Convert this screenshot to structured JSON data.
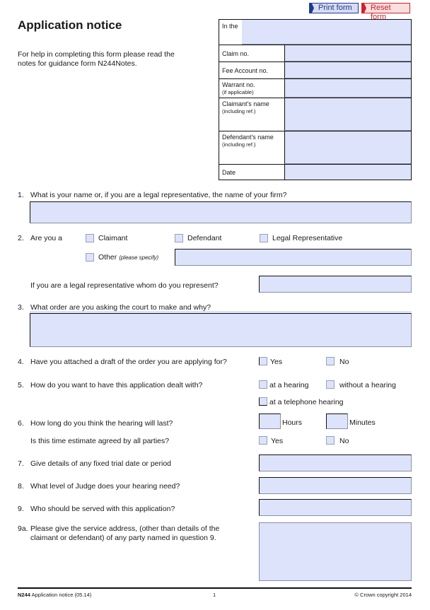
{
  "toolbar": {
    "print_label": "Print form",
    "reset_label": "Reset form",
    "print_color": "#1f3a94",
    "reset_color": "#d0202a"
  },
  "header": {
    "title": "Application notice",
    "help_line1": "For help in completing this form please read the",
    "help_line2": "notes for guidance form N244Notes."
  },
  "court_box": {
    "in_the": "In the",
    "claim_no": "Claim no.",
    "fee_account_no": "Fee Account no.",
    "warrant_no": "Warrant no.",
    "warrant_sub": "(if applicable)",
    "claimant_name": "Claimant's name",
    "claimant_sub": "(including ref.)",
    "defendant_name": "Defendant's name",
    "defendant_sub": "(including ref.)",
    "date": "Date",
    "field_color": "#dde3fb"
  },
  "questions": {
    "q1": {
      "num": "1.",
      "text": "What is your name or, if you are a legal representative, the name of your firm?"
    },
    "q2": {
      "num": "2.",
      "text": "Are you a",
      "options": [
        "Claimant",
        "Defendant",
        "Legal Representative"
      ],
      "other_label": "Other",
      "other_hint": "(please specify)",
      "rep_text": "If you are a legal representative whom do you represent?"
    },
    "q3": {
      "num": "3.",
      "text": "What order are you asking the court to make and why?"
    },
    "q4": {
      "num": "4.",
      "text": "Have you attached a draft of the order you are applying for?",
      "yes": "Yes",
      "no": "No"
    },
    "q5": {
      "num": "5.",
      "text": "How do you want to have this application dealt with?",
      "options": [
        "at a hearing",
        "without a hearing",
        "at a telephone hearing"
      ]
    },
    "q6": {
      "num": "6.",
      "text": "How long do you think the hearing will last?",
      "hours": "Hours",
      "minutes": "Minutes",
      "agreed_text": "Is this time estimate agreed by all parties?",
      "yes": "Yes",
      "no": "No"
    },
    "q7": {
      "num": "7.",
      "text": "Give details of any fixed trial date or period"
    },
    "q8": {
      "num": "8.",
      "text": "What level of Judge does your hearing need?"
    },
    "q9": {
      "num": "9.",
      "text": "Who should be served with this application?"
    },
    "q9a": {
      "num": "9a.",
      "line1": "Please give the service address, (other than details of the",
      "line2": "claimant or defendant) of any party named in question 9."
    }
  },
  "footer": {
    "form_code": "N244",
    "form_name": "Application notice (05.14)",
    "page_number": "1",
    "copyright": "© Crown copyright 2014"
  }
}
